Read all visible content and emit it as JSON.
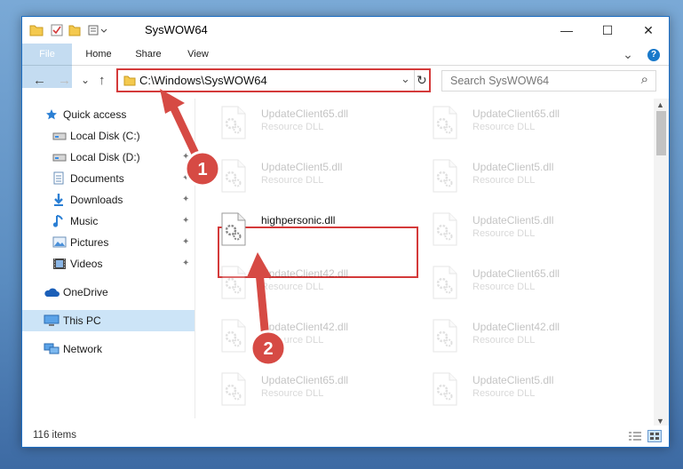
{
  "window": {
    "title": "SysWOW64",
    "minimize_glyph": "—",
    "maximize_glyph": "☐",
    "close_glyph": "✕",
    "help_glyph": "?"
  },
  "ribbon": {
    "tabs": [
      "File",
      "Home",
      "Share",
      "View"
    ],
    "expand_glyph": "⌄"
  },
  "address_bar": {
    "path": "C:\\Windows\\SysWOW64",
    "dropdown_glyph": "⌄",
    "refresh_glyph": "↻",
    "back_glyph": "←",
    "forward_glyph": "→",
    "recent_glyph": "⌄",
    "up_glyph": "↑"
  },
  "search": {
    "placeholder": "Search SysWOW64",
    "icon_glyph": "⌕"
  },
  "sidebar": {
    "items": [
      {
        "label": "Quick access",
        "icon": "star-icon",
        "pinned": false
      },
      {
        "label": "Local Disk (C:)",
        "icon": "drive-icon",
        "pinned": true
      },
      {
        "label": "Local Disk (D:)",
        "icon": "drive-icon",
        "pinned": true
      },
      {
        "label": "Documents",
        "icon": "documents-icon",
        "pinned": true
      },
      {
        "label": "Downloads",
        "icon": "downloads-icon",
        "pinned": true
      },
      {
        "label": "Music",
        "icon": "music-icon",
        "pinned": true
      },
      {
        "label": "Pictures",
        "icon": "pictures-icon",
        "pinned": true
      },
      {
        "label": "Videos",
        "icon": "videos-icon",
        "pinned": true
      },
      {
        "label": "OneDrive",
        "icon": "cloud-icon",
        "pinned": false
      },
      {
        "label": "This PC",
        "icon": "computer-icon",
        "pinned": false,
        "selected": true
      },
      {
        "label": "Network",
        "icon": "network-icon",
        "pinned": false
      }
    ],
    "pin_glyph": "📌"
  },
  "files": [
    {
      "name": "UpdateClient65.dll",
      "desc": "Resource DLL"
    },
    {
      "name": "UpdateClient65.dll",
      "desc": "Resource DLL"
    },
    {
      "name": "UpdateClient5.dll",
      "desc": "Resource DLL"
    },
    {
      "name": "UpdateClient5.dll",
      "desc": "Resource DLL"
    },
    {
      "name": "highpersonic.dll",
      "desc": "",
      "highlighted": true
    },
    {
      "name": "UpdateClient5.dll",
      "desc": "Resource DLL"
    },
    {
      "name": "UpdateClient42.dll",
      "desc": "Resource DLL"
    },
    {
      "name": "UpdateClient65.dll",
      "desc": "Resource DLL"
    },
    {
      "name": "UpdateClient42.dll",
      "desc": "Resource DLL"
    },
    {
      "name": "UpdateClient42.dll",
      "desc": "Resource DLL"
    },
    {
      "name": "UpdateClient65.dll",
      "desc": "Resource DLL"
    },
    {
      "name": "UpdateClient5.dll",
      "desc": "Resource DLL"
    }
  ],
  "status": {
    "item_count": "116 items"
  },
  "annotations": [
    {
      "number": "1"
    },
    {
      "number": "2"
    }
  ],
  "colors": {
    "accent": "#1979ca",
    "highlight_border": "#d43a3a",
    "selected_bg": "#cce4f7"
  }
}
